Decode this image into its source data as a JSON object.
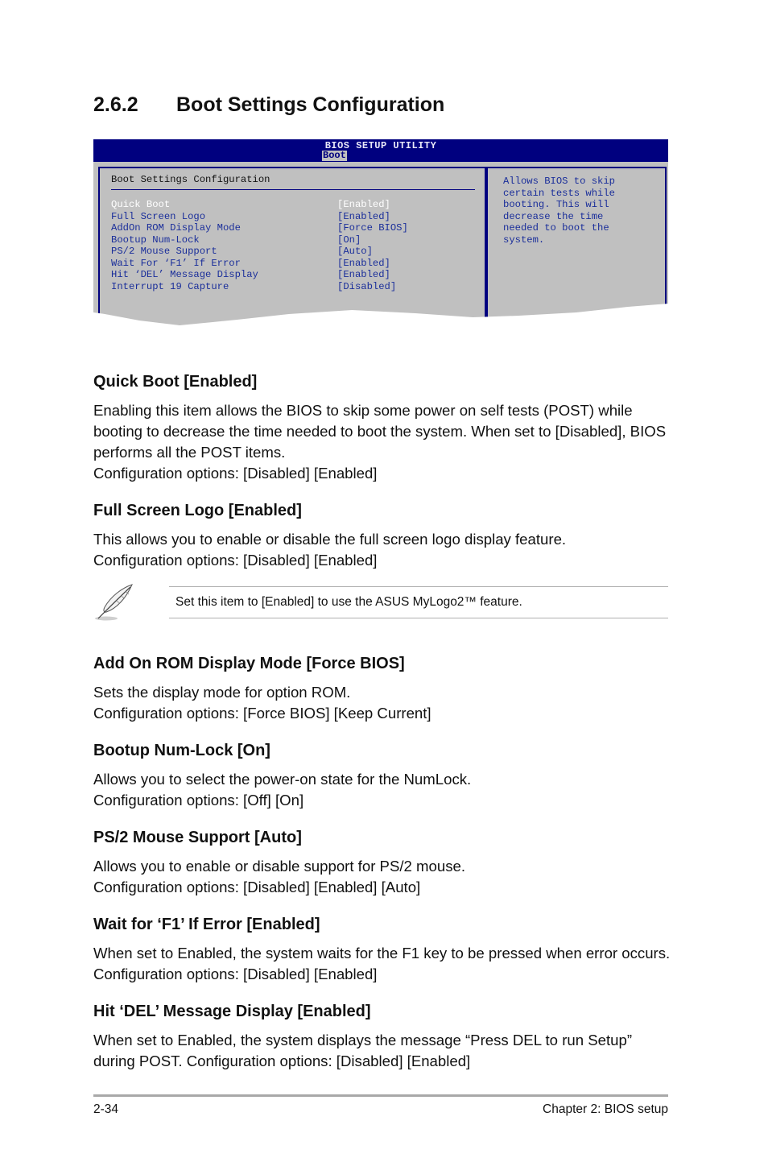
{
  "section": {
    "number": "2.6.2",
    "title": "Boot Settings Configuration"
  },
  "bios": {
    "title": "BIOS SETUP UTILITY",
    "active_tab": "Boot",
    "panel_heading": "Boot Settings Configuration",
    "items": [
      {
        "label": "Quick Boot",
        "value": "[Enabled]",
        "selected": true
      },
      {
        "label": "Full Screen Logo",
        "value": "[Enabled]",
        "selected": false
      },
      {
        "label": "AddOn ROM Display Mode",
        "value": "[Force BIOS]",
        "selected": false
      },
      {
        "label": "Bootup Num-Lock",
        "value": "[On]",
        "selected": false
      },
      {
        "label": "PS/2 Mouse Support",
        "value": "[Auto]",
        "selected": false
      },
      {
        "label": "Wait For ‘F1’ If Error",
        "value": "[Enabled]",
        "selected": false
      },
      {
        "label": "Hit ‘DEL’ Message Display",
        "value": "[Enabled]",
        "selected": false
      },
      {
        "label": "Interrupt 19 Capture",
        "value": "[Disabled]",
        "selected": false
      }
    ],
    "help_text": "Allows BIOS to skip\ncertain tests while\nbooting. This will\ndecrease the time\nneeded to boot the\nsystem.",
    "colors": {
      "header": "#00007f",
      "panel": "#c0c0c0",
      "item_text": "#1a2e9a",
      "selected_text": "#ffffff"
    }
  },
  "subsections": [
    {
      "heading": "Quick Boot [Enabled]",
      "body": "Enabling this item allows the BIOS to skip some power on self tests (POST) while booting to decrease the time needed to boot the system. When set to [Disabled], BIOS performs all the POST items.\nConfiguration options: [Disabled] [Enabled]"
    },
    {
      "heading": "Full Screen Logo [Enabled]",
      "body": "This allows you to enable or disable the full screen logo display feature.\nConfiguration options: [Disabled] [Enabled]"
    },
    {
      "heading": "Add On ROM Display Mode [Force BIOS]",
      "body": "Sets the display mode for option ROM.\nConfiguration options: [Force BIOS] [Keep Current]"
    },
    {
      "heading": "Bootup Num-Lock [On]",
      "body": "Allows you to select the power-on state for the NumLock.\nConfiguration options: [Off] [On]"
    },
    {
      "heading": "PS/2 Mouse Support [Auto]",
      "body": "Allows you to enable or disable support for PS/2 mouse.\nConfiguration options: [Disabled] [Enabled] [Auto]"
    },
    {
      "heading": "Wait for ‘F1’ If Error [Enabled]",
      "body": "When set to Enabled, the system waits for the F1 key to be pressed when error occurs. Configuration options: [Disabled] [Enabled]"
    },
    {
      "heading": "Hit ‘DEL’ Message Display [Enabled]",
      "body": "When set to Enabled, the system displays the message “Press DEL to run Setup” during POST. Configuration options: [Disabled] [Enabled]"
    }
  ],
  "note": {
    "icon": "feather-pen-icon",
    "text": "Set this item to [Enabled] to use the ASUS MyLogo2™ feature."
  },
  "footer": {
    "page_number": "2-34",
    "chapter": "Chapter 2: BIOS setup"
  }
}
